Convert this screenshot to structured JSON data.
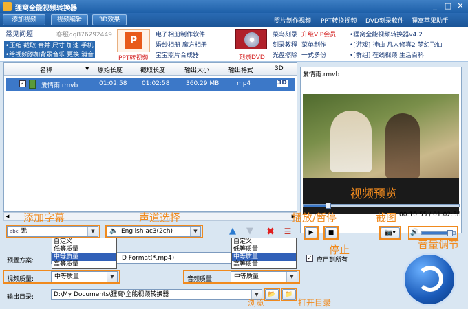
{
  "window": {
    "title": "狸窝全能视频转换器"
  },
  "toolbar": {
    "add_video": "添加视频",
    "edit_video": "视频编辑",
    "effect_3d": "3D效果",
    "links": [
      "照片制作视频",
      "PPT转换视频",
      "DVD刻录软件",
      "狸窝苹果助手"
    ]
  },
  "banner": {
    "faq_title": "常见问题",
    "service_qq": "客服qq876292449",
    "faq_line1": "•压缩 截取 合并 尺寸 加速 手机",
    "faq_line2": "•给视频添加背景音乐 更换 消音",
    "ppt_label": "PPT转视频",
    "ppt_links": [
      "电子相册制作软件",
      "婚纱相册 魔方相册",
      "宝宝照片合成器"
    ],
    "dvd_label": "刻录DVD",
    "dvd_links": [
      "菜鸟刻录",
      "升级VIP会员",
      "刻录教程",
      "菜单制作",
      "光盘擦除",
      "一式多份"
    ],
    "right_links": [
      "•狸窝全能视频转换器v4.2",
      "•[游戏] 神曲 凡人修真2 梦幻飞仙",
      "•[群组] 在线视频 生活百科"
    ]
  },
  "table": {
    "headers": [
      "名称",
      "原始长度",
      "截取长度",
      "输出大小",
      "输出格式",
      "3D"
    ],
    "rows": [
      {
        "name": "爱情雨.rmvb",
        "original": "01:02:58",
        "cut": "01:02:58",
        "size": "360.29 MB",
        "format": "mp4",
        "d3": "3D"
      }
    ]
  },
  "preview": {
    "filename": "爱情雨.rmvb",
    "time": "00:10:55 / 01:02:58",
    "progress": 0.16,
    "volume": 0.85
  },
  "controls": {
    "subtitle_value": "无",
    "audio_value": "English ac3(2ch)"
  },
  "settings": {
    "preset_label": "预置方案:",
    "preset_value": "D Format(*.mp4)",
    "apply_all": "应用到所有",
    "video_quality_label": "视频质量:",
    "video_quality_value": "中等质量",
    "audio_quality_label": "音频质量:",
    "audio_quality_value": "中等质量",
    "output_label": "输出目录:",
    "output_path": "D:\\My Documents\\狸窝\\全能视频转换器"
  },
  "quality_options": [
    "自定义",
    "低等质量",
    "中等质量",
    "高等质量"
  ],
  "annotations": {
    "add_subtitle": "添加字幕",
    "audio_select": "声道选择",
    "play_pause": "播放/暂停",
    "screenshot": "截图",
    "stop": "停止",
    "volume": "音量调节",
    "video_preview": "视频预览",
    "browse": "浏览",
    "open_dir": "打开目录"
  }
}
